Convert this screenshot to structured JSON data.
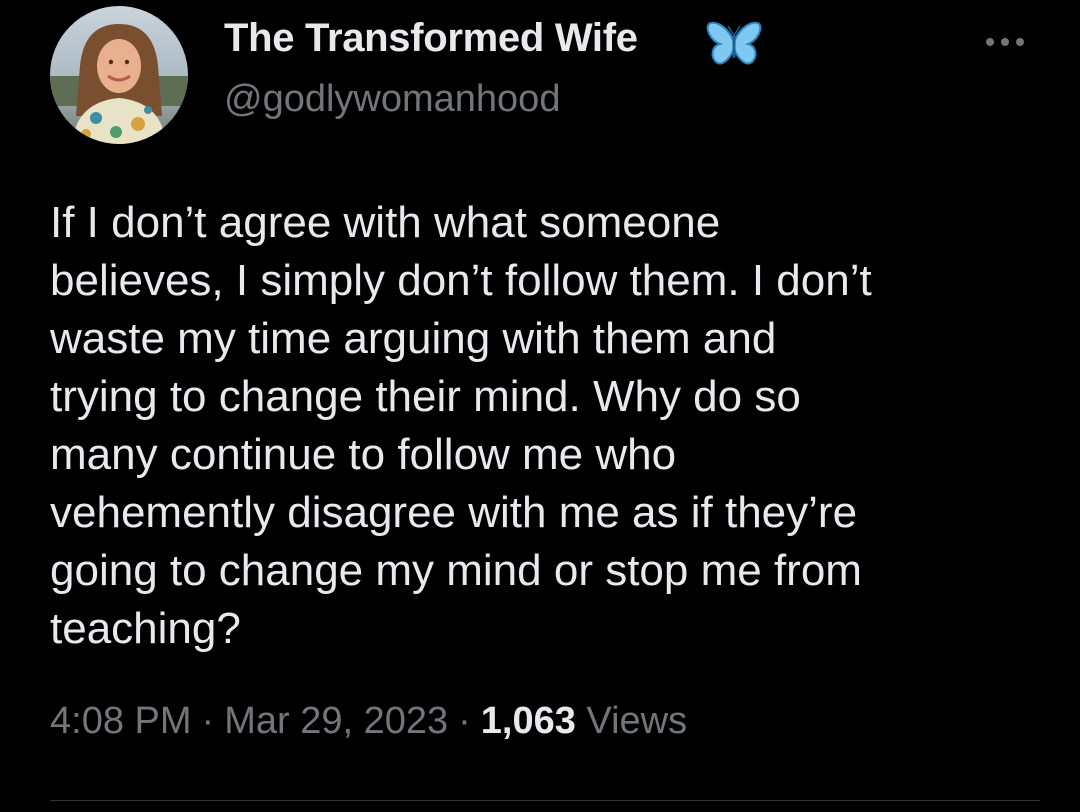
{
  "author": {
    "display_name": "The Transformed Wife",
    "handle": "@godlywomanhood",
    "badge_icon": "butterfly-icon",
    "badge_color": "#7fc8f0"
  },
  "tweet": {
    "text": "If I don’t agree with what someone\nbelieves, I simply don’t follow them. I don’t\nwaste my time arguing with them and\ntrying to change their mind. Why do so\nmany continue to follow me who\nvehemently disagree with me as if they’re\ngoing to change my mind or stop me from\nteaching?",
    "time": "4:08 PM",
    "separator": "·",
    "date": "Mar 29, 2023",
    "views_count": "1,063",
    "views_label": "Views"
  },
  "colors": {
    "background": "#000000",
    "primary_text": "#e7e9ea",
    "secondary_text": "#71767b",
    "divider": "#2f3336"
  },
  "icons": {
    "more": "more-options-icon"
  }
}
